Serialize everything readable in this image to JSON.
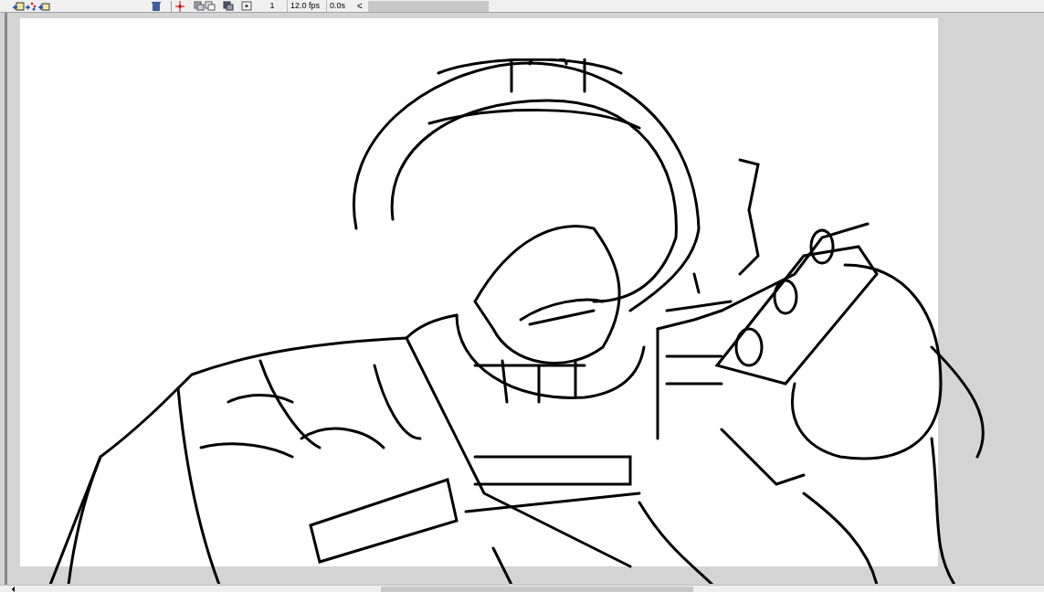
{
  "timeline_toolbar": {
    "current_frame": "1",
    "frame_rate": "12.0 fps",
    "elapsed_time": "0.0s",
    "scroll_left": "<"
  }
}
